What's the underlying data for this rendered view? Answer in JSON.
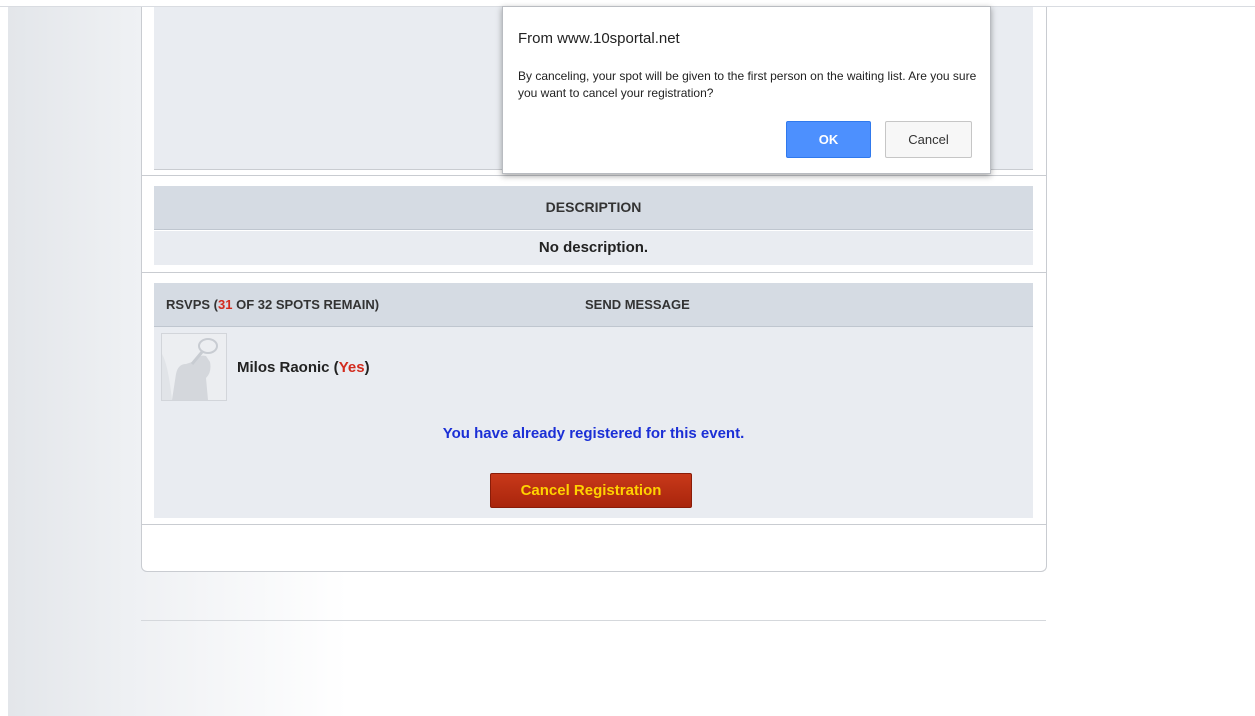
{
  "dialog": {
    "title": "From www.10sportal.net",
    "message": "By canceling, your spot will be given to the first person on the waiting list.  Are you sure you want to cancel your registration?",
    "ok_label": "OK",
    "cancel_label": "Cancel"
  },
  "description": {
    "header": "DESCRIPTION",
    "text": "No description."
  },
  "rsvps": {
    "title_prefix": "RSVPS (",
    "count": "31",
    "title_suffix": " OF 32 SPOTS REMAIN)",
    "send_message": "SEND MESSAGE",
    "attendees": [
      {
        "name": "Milos Raonic",
        "status_prefix": " (",
        "status": "Yes",
        "status_suffix": ")"
      }
    ],
    "registered_message": "You have already registered for this event.",
    "cancel_button": "Cancel Registration"
  },
  "colors": {
    "accent_red": "#d22b1e",
    "link_blue": "#1b2fd6",
    "button_gold": "#ffd200",
    "ok_blue": "#4d90fe"
  }
}
